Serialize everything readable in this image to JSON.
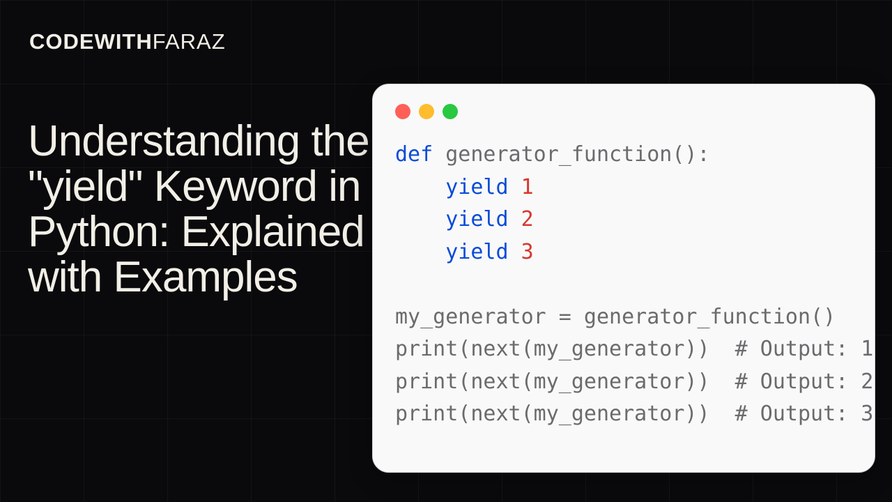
{
  "brand": {
    "bold": "CODEWITH",
    "light": "FARAZ"
  },
  "headline": "Understanding the \"yield\" Keyword in Python: Explained with Examples",
  "code": {
    "t1": "def",
    "t2": " generator_function():",
    "t3": "    ",
    "t4": "yield",
    "t5": " ",
    "n1": "1",
    "t6": "    ",
    "t7": "yield",
    "t8": " ",
    "n2": "2",
    "t9": "    ",
    "t10": "yield",
    "t11": " ",
    "n3": "3",
    "l1": "my_generator = generator_function()",
    "p1a": "print(next(my_generator))  ",
    "p1b": "# Output: 1",
    "p2a": "print(next(my_generator))  ",
    "p2b": "# Output: 2",
    "p3a": "print(next(my_generator))  ",
    "p3b": "# Output: 3"
  }
}
